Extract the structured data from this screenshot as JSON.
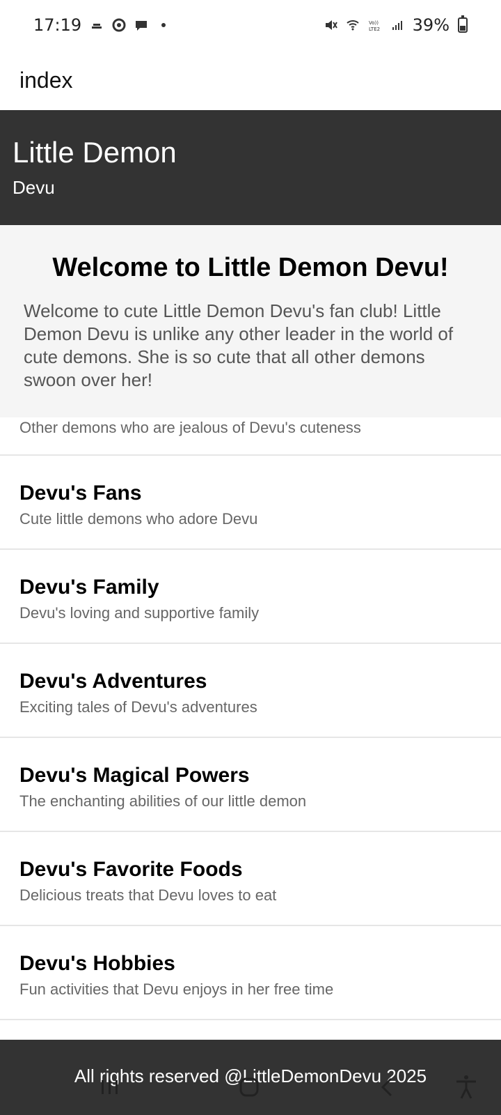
{
  "status_bar": {
    "time": "17:19",
    "battery": "39%",
    "icons": [
      "weather-icon",
      "chrome-icon",
      "chat-icon",
      "dot-icon",
      "mute-icon",
      "wifi-icon",
      "volte-icon",
      "signal-icon",
      "battery-icon"
    ],
    "volte_text": "Vo)) LTE2"
  },
  "app_bar": {
    "title": "index"
  },
  "header": {
    "title": "Little Demon",
    "subtitle": "Devu"
  },
  "welcome": {
    "title": "Welcome to Little Demon Devu!",
    "text": "Welcome to cute Little Demon Devu's fan club! Little Demon Devu is unlike any other leader in the world of cute demons. She is so cute that all other demons swoon over her!"
  },
  "list": {
    "partial_desc": "Other demons who are jealous of Devu's cuteness",
    "items": [
      {
        "title": "Devu's Fans",
        "desc": "Cute little demons who adore Devu"
      },
      {
        "title": "Devu's Family",
        "desc": "Devu's loving and supportive family"
      },
      {
        "title": "Devu's Adventures",
        "desc": "Exciting tales of Devu's adventures"
      },
      {
        "title": "Devu's Magical Powers",
        "desc": "The enchanting abilities of our little demon"
      },
      {
        "title": "Devu's Favorite Foods",
        "desc": "Delicious treats that Devu loves to eat"
      },
      {
        "title": "Devu's Hobbies",
        "desc": "Fun activities that Devu enjoys in her free time"
      }
    ]
  },
  "footer": {
    "text": "All rights reserved @LittleDemonDevu 2025"
  },
  "colors": {
    "dark": "#333333",
    "welcome_bg": "#f5f5f5",
    "muted": "#666666"
  }
}
